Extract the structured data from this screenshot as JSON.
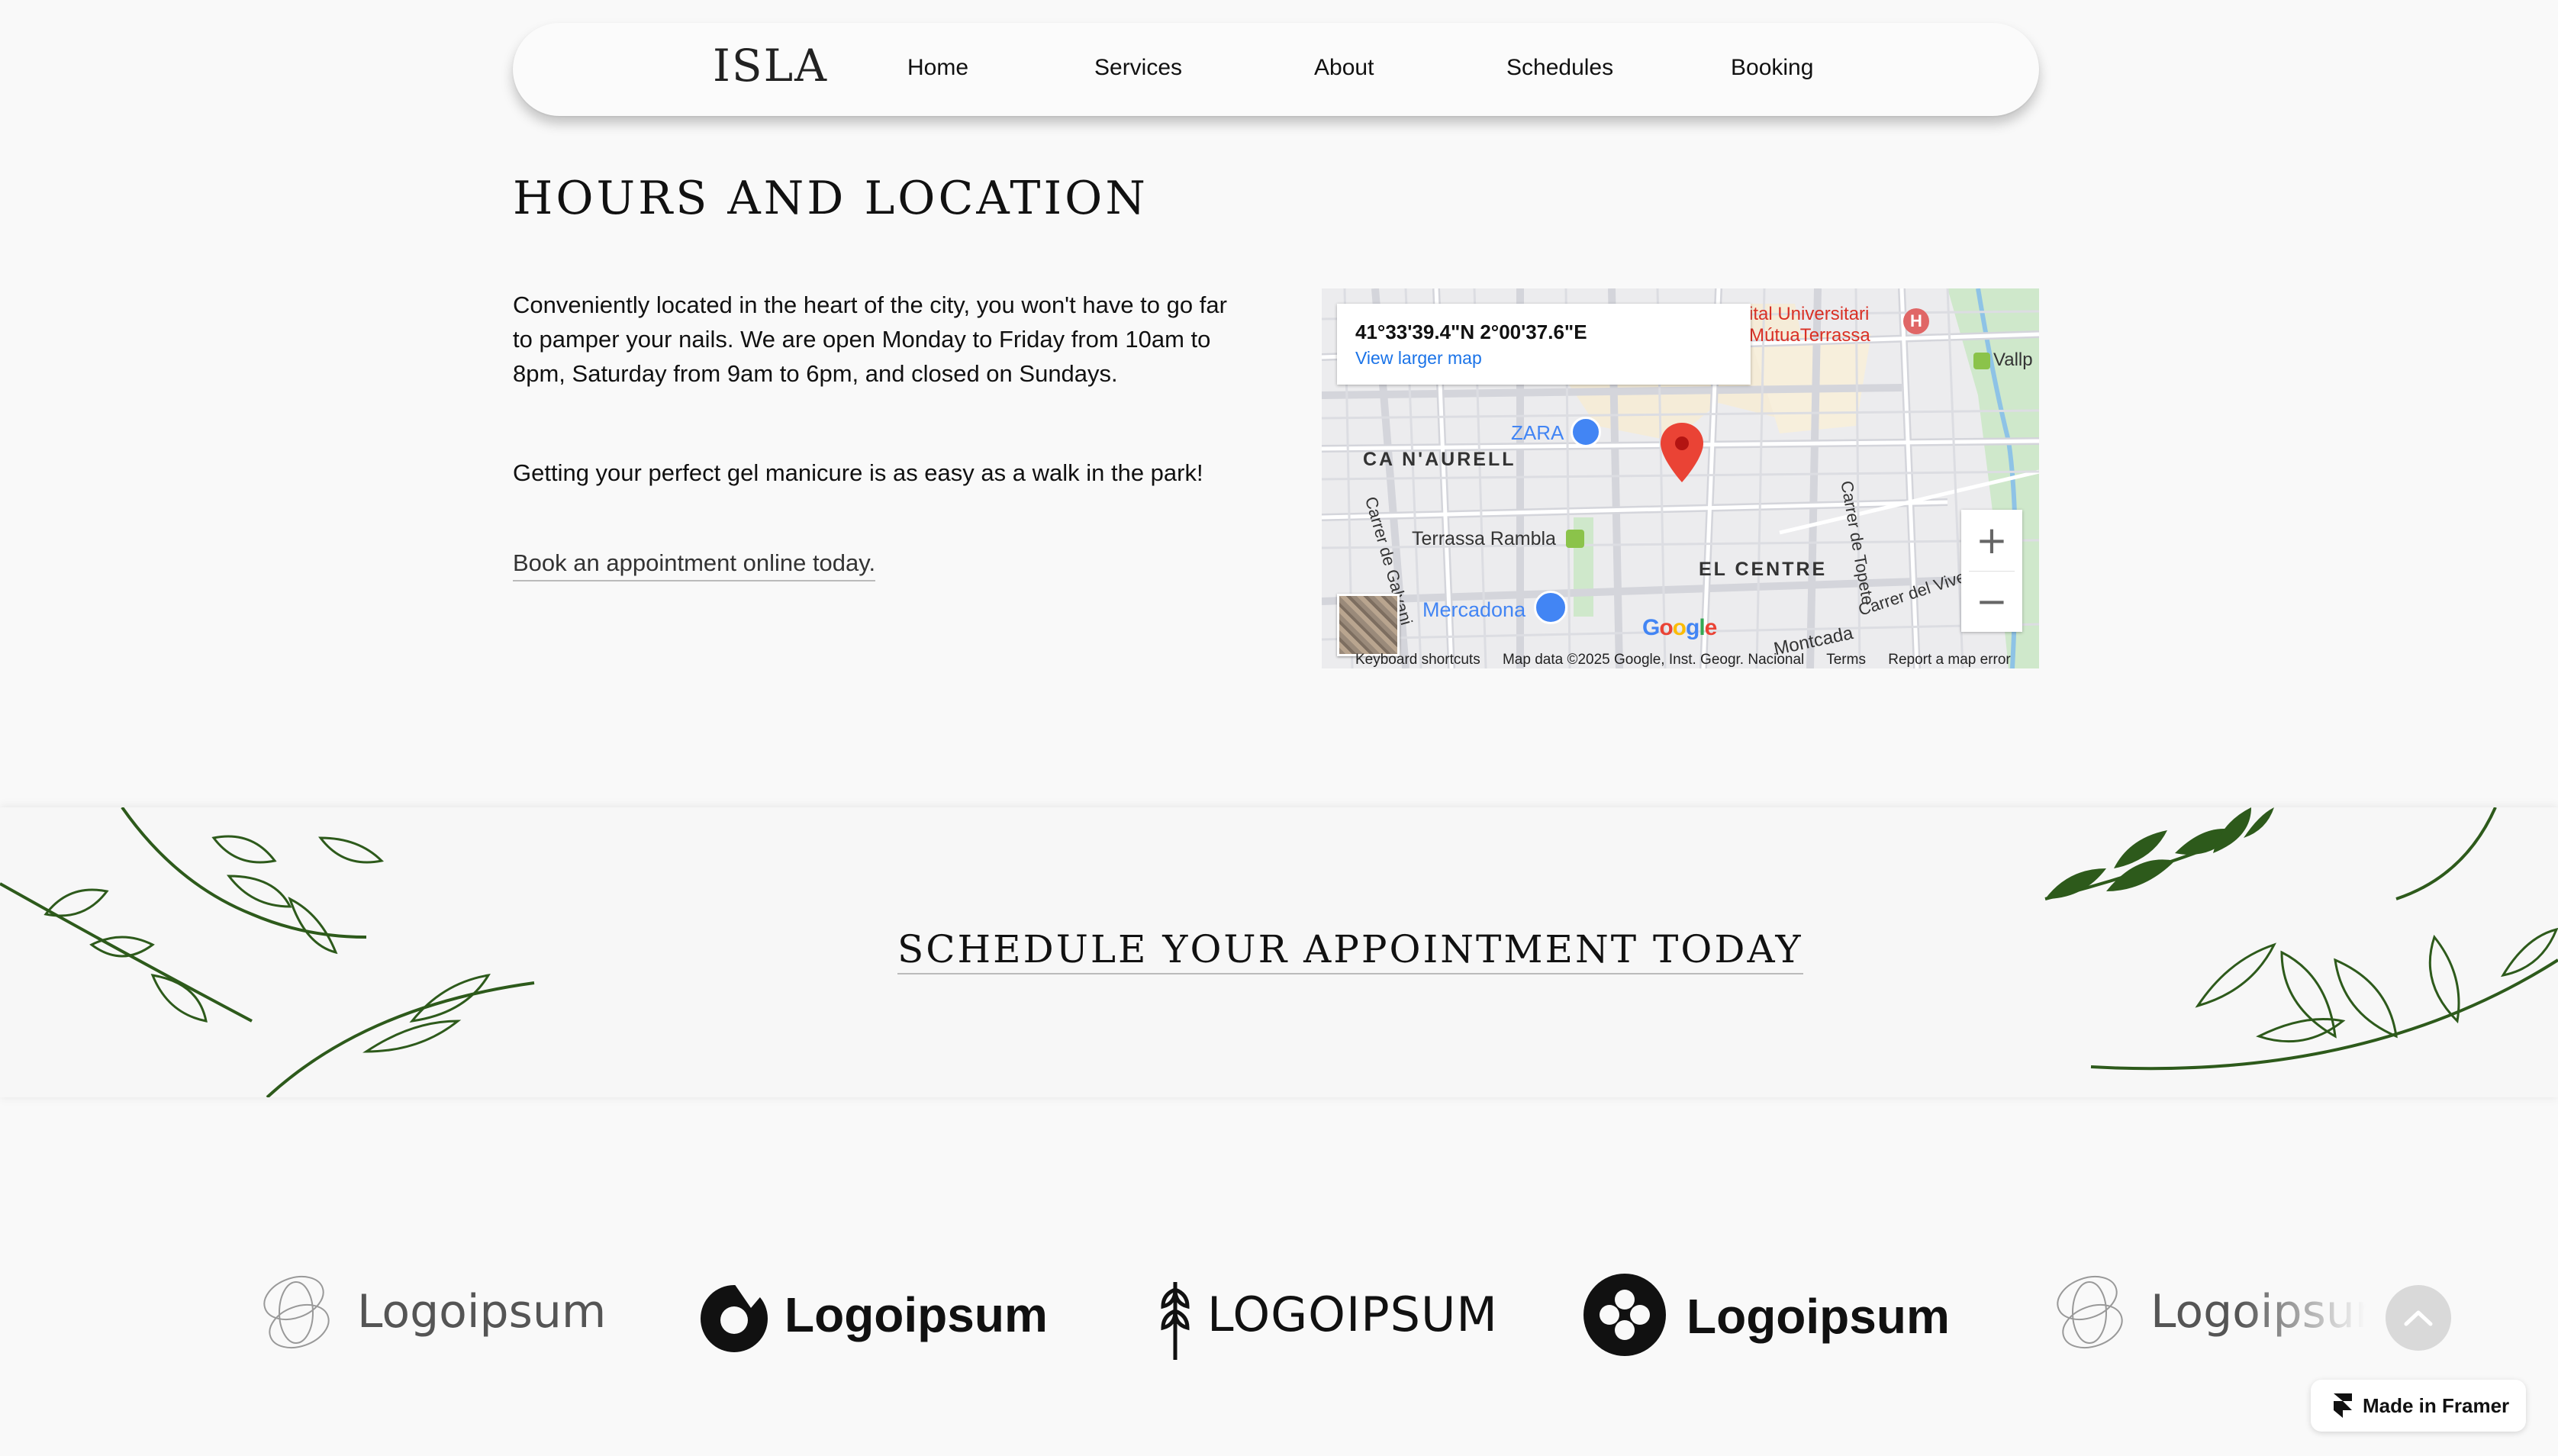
{
  "nav": {
    "logo": "ISLA",
    "links": [
      "Home",
      "Services",
      "About",
      "Schedules",
      "Booking"
    ]
  },
  "hours": {
    "title": "HOURS AND LOCATION",
    "paragraph1": "Conveniently located in the heart of the city, you won't have to go far to pamper your nails. We are open Monday to Friday from 10am to 8pm, Saturday from 9am to 6pm, and closed on Sundays.",
    "paragraph2": "Getting your perfect gel manicure is as easy as a walk in the park!",
    "book_link": "Book an appointment online today."
  },
  "map": {
    "coords": "41°33'39.4\"N 2°00'37.6\"E",
    "view_larger": "View larger map",
    "labels": {
      "hospital": "ital Universitari MútuaTerrassa",
      "vallp": "Vallp",
      "zara": "ZARA",
      "ca_naurell": "CA N'AURELL",
      "terrassa_rambla": "Terrassa Rambla",
      "el_centre": "EL CENTRE",
      "mercadona": "Mercadona",
      "carrer_topete": "Carrer de Topete",
      "carrer_galvani": "Carrer de Galvani",
      "carrer_viver": "Carrer del Viver",
      "montcada": "Montcada",
      "google": "Google"
    },
    "footer": [
      "Keyboard shortcuts",
      "Map data ©2025 Google, Inst. Geogr. Nacional",
      "Terms",
      "Report a map error"
    ],
    "zoom_in": "+",
    "zoom_out": "−",
    "colors": {
      "pin": "#ea4335",
      "poi_blue": "#4285f4",
      "hospital": "#d93025",
      "park": "#c8e6c0"
    }
  },
  "banner": {
    "title": "SCHEDULE YOUR APPOINTMENT TODAY",
    "leaf_color": "#2d5a1b"
  },
  "logos": [
    "Logoipsum",
    "Logoipsum",
    "LOGOIPSUM",
    "Logoipsum",
    "Logoipsum"
  ],
  "framer": {
    "label": "Made in Framer"
  }
}
